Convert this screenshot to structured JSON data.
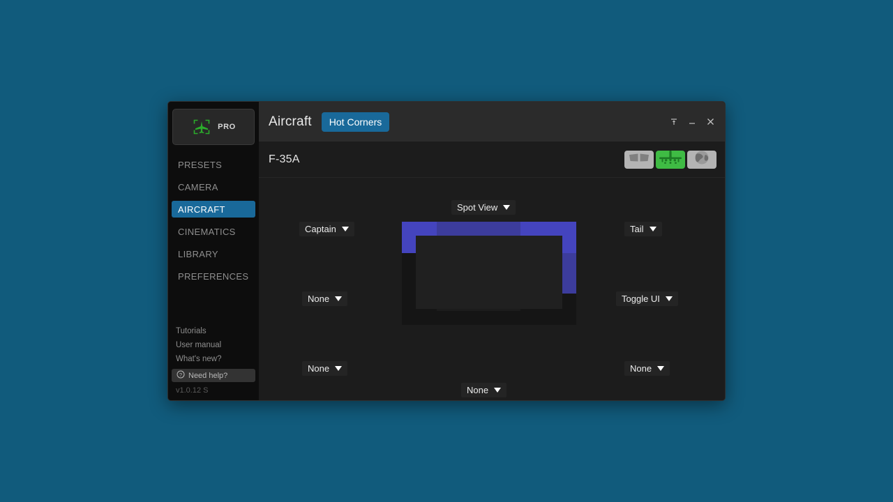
{
  "desktop": {
    "background_color": "#115b7c"
  },
  "sidebar": {
    "brand": {
      "label": "PRO",
      "logo_icon": "aircraft-bracket-logo",
      "logo_color": "#2bac2b"
    },
    "items": [
      {
        "label": "PRESETS",
        "active": false
      },
      {
        "label": "CAMERA",
        "active": false
      },
      {
        "label": "AIRCRAFT",
        "active": true
      },
      {
        "label": "CINEMATICS",
        "active": false
      },
      {
        "label": "LIBRARY",
        "active": false
      },
      {
        "label": "PREFERENCES",
        "active": false
      }
    ],
    "links": [
      {
        "label": "Tutorials"
      },
      {
        "label": "User manual"
      },
      {
        "label": "What's new?"
      }
    ],
    "need_help": {
      "label": "Need help?",
      "icon": "question-circle-icon"
    },
    "version": "v1.0.12 S",
    "accent_color": "#19699a"
  },
  "titlebar": {
    "title": "Aircraft",
    "tab": {
      "label": "Hot Corners",
      "active": true
    },
    "controls": [
      {
        "name": "pin-to-top",
        "icon": "pin-top-icon"
      },
      {
        "name": "minimize",
        "icon": "minimize-icon"
      },
      {
        "name": "close",
        "icon": "close-icon"
      }
    ]
  },
  "subheader": {
    "aircraft_name": "F-35A",
    "mode_buttons": [
      {
        "name": "cockpit-view",
        "icon": "cockpit-windows-icon",
        "active": false
      },
      {
        "name": "exterior-view",
        "icon": "aircraft-front-icon",
        "active": true
      },
      {
        "name": "world-view",
        "icon": "globe-icon",
        "active": false
      }
    ],
    "active_color": "#3fbb44",
    "inactive_color": "#b4b4b4"
  },
  "hot_corners": {
    "assignments": [
      {
        "slot": "top-left",
        "value": "Captain",
        "assigned": true
      },
      {
        "slot": "top-center",
        "value": "Spot View",
        "assigned": true
      },
      {
        "slot": "top-right",
        "value": "Tail",
        "assigned": true
      },
      {
        "slot": "middle-left",
        "value": "None",
        "assigned": false
      },
      {
        "slot": "middle-right",
        "value": "Toggle UI",
        "assigned": true
      },
      {
        "slot": "bottom-left",
        "value": "None",
        "assigned": false
      },
      {
        "slot": "bottom-center",
        "value": "None",
        "assigned": false
      },
      {
        "slot": "bottom-right",
        "value": "None",
        "assigned": false
      }
    ],
    "highlight_bright": "#4444be",
    "highlight_dim": "#3c3c9c",
    "empty_color": "#151515"
  }
}
